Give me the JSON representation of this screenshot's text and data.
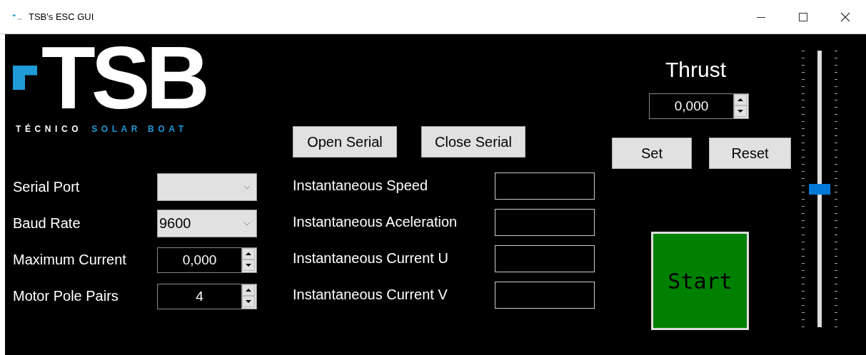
{
  "window": {
    "title": "TSB's ESC GUI"
  },
  "logo": {
    "mark": "TSB",
    "tagline_white": "TÉCNICO",
    "tagline_blue": "SOLAR BOAT"
  },
  "serial_buttons": [
    "Open Serial",
    "Close Serial"
  ],
  "settings": [
    {
      "kind": "dropdown",
      "label": "Serial Port"
    },
    {
      "kind": "dropdown",
      "label": "Baud Rate",
      "value": "9600"
    },
    {
      "kind": "spinner",
      "label": "Maximum Current",
      "value": "0,000"
    },
    {
      "kind": "spinner",
      "label": "Motor Pole Pairs",
      "value": "4"
    }
  ],
  "readouts": [
    {
      "label": "Instantaneous Speed"
    },
    {
      "label": "Instantaneous Aceleration"
    },
    {
      "label": "Instantaneous Current U"
    },
    {
      "label": "Instantaneous Current V"
    }
  ],
  "thrust": {
    "title": "Thrust",
    "value": "0,000",
    "buttons": [
      "Set",
      "Reset"
    ],
    "slider": {
      "level": 0.5
    }
  },
  "start_button": "Start"
}
